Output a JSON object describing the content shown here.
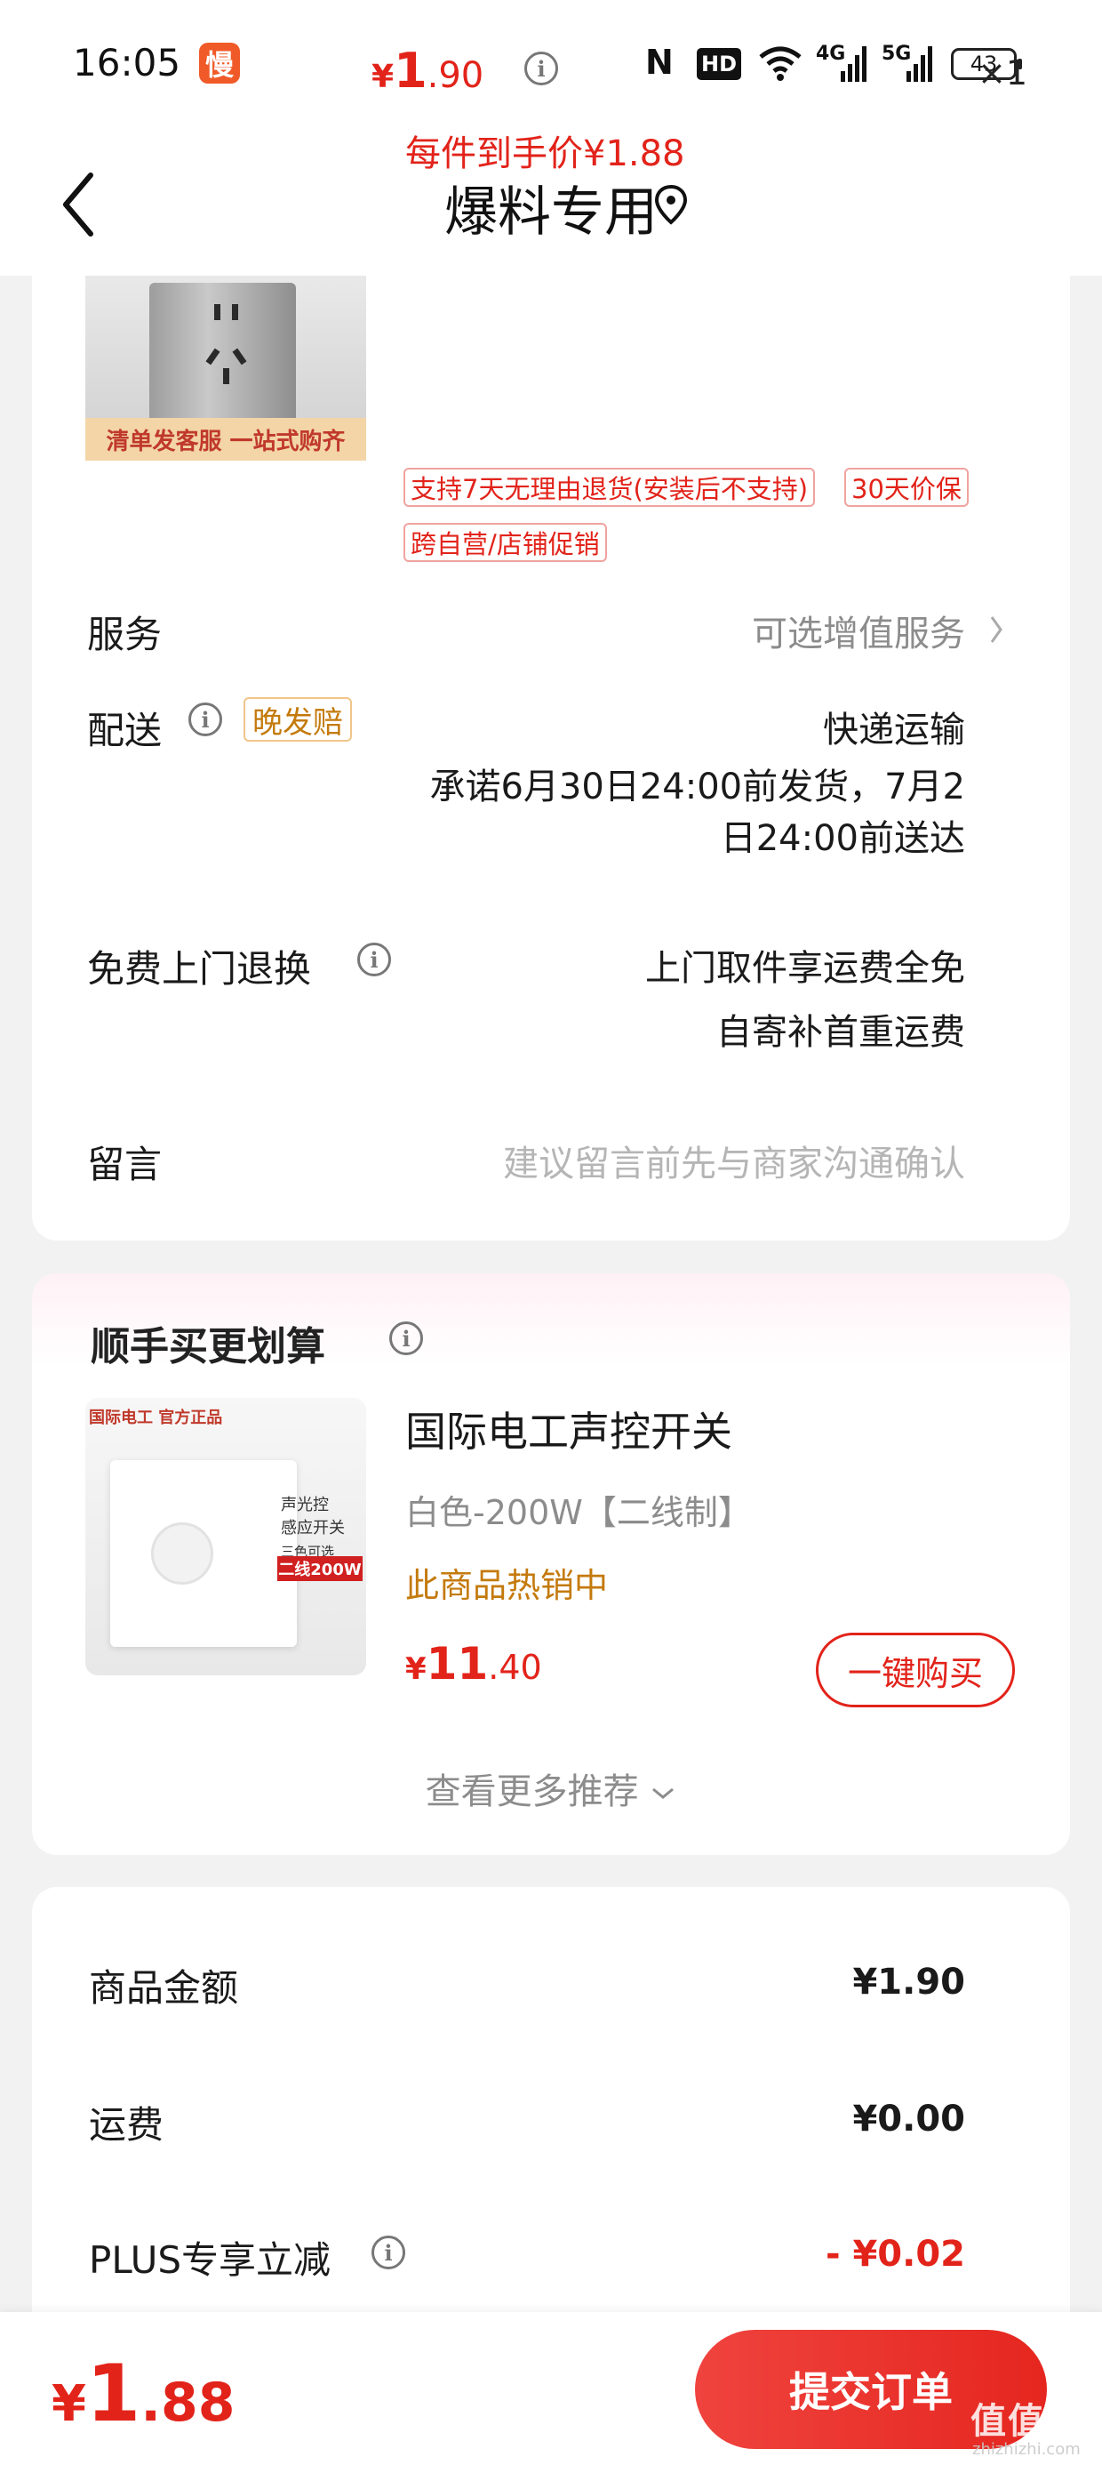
{
  "status_bar": {
    "time": "16:05",
    "app_badge": "慢",
    "nfc": "N",
    "hd": "HD",
    "signal_1": "4G",
    "signal_2": "5G",
    "battery": "43"
  },
  "nav": {
    "title": "爆料专用"
  },
  "product": {
    "image_banner": "清单发客服 一站式购齐",
    "price_currency": "¥",
    "price_int": "1",
    "price_dec": ".90",
    "quantity": "×1",
    "final_price": "每件到手价¥1.88",
    "tags": [
      "支持7天无理由退货(安装后不支持)",
      "30天价保",
      "跨自营/店铺促销"
    ]
  },
  "service": {
    "label": "服务",
    "value": "可选增值服务"
  },
  "delivery": {
    "label": "配送",
    "tag": "晚发赔",
    "method": "快递运输",
    "promise_line1": "承诺6月30日24:00前发货，7月2",
    "promise_line2": "日24:00前送达"
  },
  "return_service": {
    "label": "免费上门退换",
    "line1": "上门取件享运费全免",
    "line2": "自寄补首重运费"
  },
  "message": {
    "label": "留言",
    "placeholder": "建议留言前先与商家沟通确认"
  },
  "recommend": {
    "title": "顺手买更划算",
    "item_name": "国际电工声控开关",
    "item_spec": "白色-200W【二线制】",
    "item_hot": "此商品热销中",
    "price_currency": "¥",
    "price_int": "11",
    "price_dec": ".40",
    "buy_button": "一键购买",
    "more": "查看更多推荐",
    "image_text": {
      "brand": "国际电工 官方正品",
      "label_1": "声光控",
      "label_2": "感应开关",
      "label_3": "三色可选",
      "label_4": "二线200W"
    }
  },
  "summary": {
    "rows": [
      {
        "label": "商品金额",
        "value": "¥1.90"
      },
      {
        "label": "运费",
        "value": "¥0.00"
      },
      {
        "label": "PLUS专享立减",
        "value": "- ¥0.02"
      }
    ]
  },
  "bottom": {
    "total_currency": "¥",
    "total_int": "1",
    "total_dec": ".88",
    "submit": "提交订单",
    "watermark": "值值值",
    "watermark_sub": "zhizhizhi.com"
  },
  "colors": {
    "accent": "#e2231a",
    "warning": "#c47a0c",
    "muted": "#8c8c8c",
    "background": "#f2f2f2"
  },
  "icons": [
    "back-chevron-icon",
    "location-pin-icon",
    "info-icon",
    "chevron-right-icon",
    "chevron-down-icon",
    "wifi-icon",
    "battery-icon"
  ]
}
